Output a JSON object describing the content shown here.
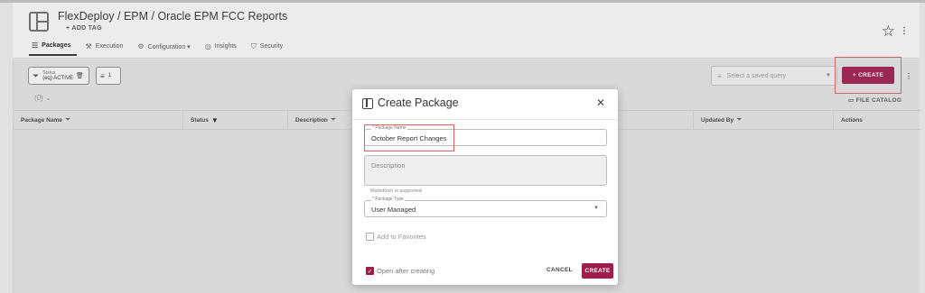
{
  "header": {
    "breadcrumb": "FlexDeploy / EPM / Oracle EPM FCC Reports",
    "add_tag": "+ ADD TAG",
    "tabs": [
      {
        "label": "Packages",
        "icon": "list-icon",
        "active": true
      },
      {
        "label": "Execution",
        "icon": "running-icon",
        "active": false
      },
      {
        "label": "Configuration ▾",
        "icon": "gear-icon",
        "active": false
      },
      {
        "label": "Insights",
        "icon": "insights-icon",
        "active": false
      },
      {
        "label": "Security",
        "icon": "shield-icon",
        "active": false
      }
    ]
  },
  "toolbar": {
    "status_chip_key": "Status",
    "status_chip_value": "(eq) ACTIVE",
    "filter_count": "1",
    "rows_label": "(0)  ⌄",
    "query_placeholder": "Select a saved query",
    "create_label": "+ CREATE",
    "file_catalog_label": "FILE CATALOG"
  },
  "table": {
    "columns": [
      "Package Name",
      "Status",
      "Description",
      "Updated By",
      "Actions"
    ]
  },
  "modal": {
    "title": "Create Package",
    "package_name_label": "* Package Name",
    "package_name_value": "October Report Changes",
    "description_placeholder": "Description",
    "markdown_help": "Markdown is supported",
    "package_type_label": "* Package Type",
    "package_type_value": "User Managed",
    "add_to_favorites": "Add to Favorites",
    "open_after_creating": "Open after creating",
    "cancel_label": "CANCEL",
    "create_label": "CREATE"
  },
  "colors": {
    "accent": "#a11b4b",
    "highlight": "#e06060"
  }
}
